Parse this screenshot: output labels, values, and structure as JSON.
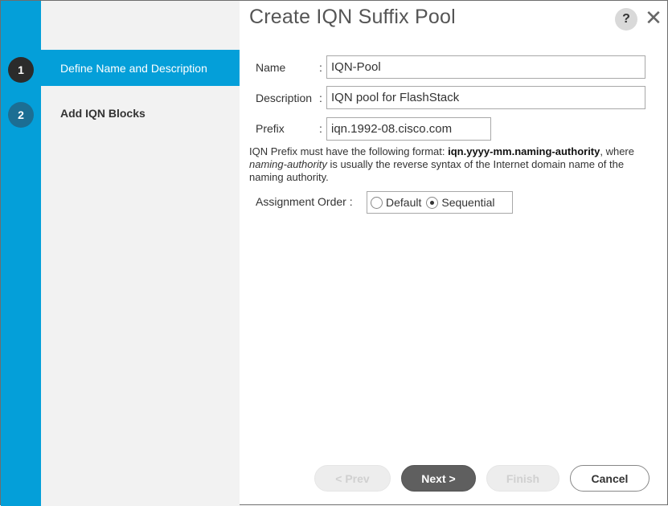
{
  "dialog": {
    "title": "Create IQN Suffix Pool",
    "help_glyph": "?",
    "close_glyph": "✕"
  },
  "steps": [
    {
      "number": "1",
      "label": "Define Name and Description",
      "active": true
    },
    {
      "number": "2",
      "label": "Add IQN Blocks",
      "active": false
    }
  ],
  "form": {
    "name_label": "Name",
    "name_value": "IQN-Pool",
    "description_label": "Description",
    "description_value": "IQN pool for FlashStack",
    "prefix_label": "Prefix",
    "prefix_value": "iqn.1992-08.cisco.com",
    "colon": ":",
    "hint_part1": "IQN Prefix must have the following format: ",
    "hint_format": "iqn.yyyy-mm.naming-authority",
    "hint_part2": ", where ",
    "hint_term": "naming-authority",
    "hint_part3": " is usually the reverse syntax of the Internet domain name of the naming authority.",
    "assignment_label": "Assignment Order :",
    "assignment_options": [
      "Default",
      "Sequential"
    ],
    "assignment_selected": "Sequential"
  },
  "buttons": {
    "prev": "< Prev",
    "next": "Next >",
    "finish": "Finish",
    "cancel": "Cancel"
  },
  "colors": {
    "accent": "#049fd9",
    "active_step_circle": "#2b2b2b",
    "inactive_step_circle": "#1c6e93",
    "primary_button": "#5f5f5f"
  }
}
